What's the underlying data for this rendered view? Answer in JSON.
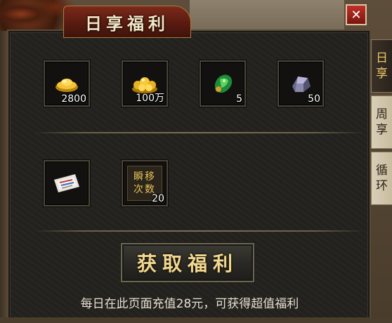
{
  "window": {
    "title": "日享福利",
    "close_label": "✕"
  },
  "side_tabs": [
    {
      "label_line1": "日",
      "label_line2": "享",
      "active": true
    },
    {
      "label_line1": "周",
      "label_line2": "享",
      "active": false
    },
    {
      "label_line1": "循",
      "label_line2": "环",
      "active": false
    }
  ],
  "rewards": [
    {
      "icon": "gold-ingot-icon",
      "quantity": "2800"
    },
    {
      "icon": "gold-coins-icon",
      "quantity": "100万"
    },
    {
      "icon": "green-gem-icon",
      "quantity": "5"
    },
    {
      "icon": "crystal-ore-icon",
      "quantity": "50"
    },
    {
      "icon": "paper-scroll-icon",
      "quantity": ""
    },
    {
      "icon": "teleport-count-icon",
      "icon_text_line1": "瞬移",
      "icon_text_line2": "次数",
      "quantity": "20"
    }
  ],
  "claim_button": {
    "label": "获取福利"
  },
  "note": "每日在此页面充值28元，可获得超值福利",
  "colors": {
    "title_bg": "#6a2214",
    "button_text": "#f1d891",
    "close_bg": "#b02a22"
  }
}
